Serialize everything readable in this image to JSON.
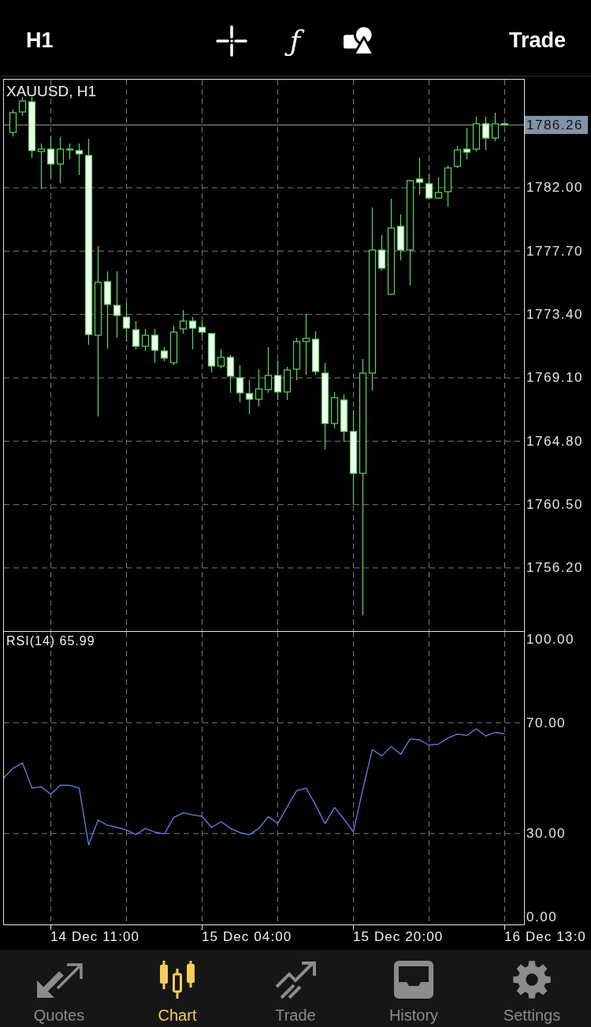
{
  "toolbar": {
    "timeframe": "H1",
    "tools": [
      {
        "kind": "crosshair"
      },
      {
        "kind": "indicators",
        "label": "ƒ"
      },
      {
        "kind": "objects"
      }
    ],
    "action": "Trade"
  },
  "price_chart": {
    "chart_data": {
      "type": "candlestick",
      "title": "XAUUSD, H1",
      "grid": true,
      "categories": [
        null,
        null,
        null,
        null,
        null,
        null,
        null,
        null,
        null,
        null,
        null,
        null,
        null,
        null,
        null,
        null,
        null,
        null,
        null,
        null,
        null,
        null,
        null,
        null,
        null,
        null,
        null,
        null,
        null,
        null,
        null,
        null,
        null,
        null,
        null,
        null,
        null,
        null,
        null,
        null,
        null,
        null,
        null,
        null,
        null,
        null,
        null,
        null,
        null,
        null,
        null,
        null,
        null
      ],
      "ohlc": [
        [
          1785.75,
          1787.3,
          1785.48,
          1787.09
        ],
        [
          1787.14,
          1788.16,
          1786.87,
          1787.89
        ],
        [
          1787.83,
          1788.16,
          1784.03,
          1784.52
        ],
        [
          1784.46,
          1785.0,
          1781.89,
          1784.62
        ],
        [
          1784.62,
          1785.53,
          1782.59,
          1783.61
        ],
        [
          1783.61,
          1785.43,
          1782.32,
          1784.62
        ],
        [
          1784.57,
          1785.0,
          1783.93,
          1784.62
        ],
        [
          1784.52,
          1785.0,
          1782.86,
          1784.3
        ],
        [
          1784.19,
          1785.32,
          1771.35,
          1772.04
        ],
        [
          1771.99,
          1778.04,
          1766.48,
          1775.58
        ],
        [
          1775.63,
          1776.33,
          1771.08,
          1774.08
        ],
        [
          1774.02,
          1776.33,
          1771.83,
          1773.33
        ],
        [
          1773.22,
          1774.18,
          1771.56,
          1772.47
        ],
        [
          1772.36,
          1772.95,
          1771.03,
          1771.24
        ],
        [
          1771.24,
          1772.42,
          1770.92,
          1771.99
        ],
        [
          1771.99,
          1772.42,
          1770.12,
          1770.97
        ],
        [
          1770.92,
          1771.19,
          1770.22,
          1770.44
        ],
        [
          1770.12,
          1772.63,
          1769.96,
          1772.2
        ],
        [
          1772.42,
          1773.7,
          1772.1,
          1772.95
        ],
        [
          1772.95,
          1773.22,
          1771.03,
          1772.47
        ],
        [
          1772.53,
          1772.9,
          1771.99,
          1772.2
        ],
        [
          1772.1,
          1772.15,
          1769.47,
          1769.9
        ],
        [
          1769.9,
          1771.03,
          1769.74,
          1770.49
        ],
        [
          1770.49,
          1770.65,
          1768.08,
          1769.21
        ],
        [
          1769.1,
          1769.96,
          1767.44,
          1768.08
        ],
        [
          1768.03,
          1768.94,
          1766.64,
          1767.65
        ],
        [
          1767.65,
          1769.69,
          1767.17,
          1768.35
        ],
        [
          1768.3,
          1771.19,
          1768.08,
          1769.26
        ],
        [
          1769.26,
          1770.28,
          1767.6,
          1768.14
        ],
        [
          1768.14,
          1769.85,
          1767.6,
          1769.63
        ],
        [
          1769.69,
          1771.83,
          1768.94,
          1771.56
        ],
        [
          1771.56,
          1773.44,
          1769.31,
          1771.78
        ],
        [
          1771.72,
          1772.26,
          1769.31,
          1769.53
        ],
        [
          1769.42,
          1770.12,
          1764.23,
          1766.0
        ],
        [
          1766.0,
          1768.14,
          1765.67,
          1767.76
        ],
        [
          1767.6,
          1767.98,
          1764.76,
          1765.46
        ],
        [
          1765.46,
          1766.9,
          1760.48,
          1762.62
        ],
        [
          1762.62,
          1770.38,
          1752.99,
          1769.42
        ],
        [
          1769.42,
          1780.66,
          1768.24,
          1777.77
        ],
        [
          1777.77,
          1778.79,
          1776.38,
          1776.54
        ],
        [
          1774.77,
          1781.25,
          1774.77,
          1779.27
        ],
        [
          1779.38,
          1780.18,
          1777.08,
          1777.77
        ],
        [
          1777.77,
          1782.54,
          1775.36,
          1782.48
        ],
        [
          1782.59,
          1784.03,
          1781.52,
          1782.37
        ],
        [
          1782.27,
          1782.96,
          1781.2,
          1781.3
        ],
        [
          1781.3,
          1782.7,
          1781.25,
          1781.68
        ],
        [
          1781.73,
          1783.5,
          1780.72,
          1783.34
        ],
        [
          1783.45,
          1784.84,
          1783.34,
          1784.57
        ],
        [
          1784.62,
          1786.07,
          1783.93,
          1784.41
        ],
        [
          1784.62,
          1786.82,
          1784.46,
          1786.34
        ],
        [
          1786.34,
          1786.82,
          1784.57,
          1785.37
        ],
        [
          1785.37,
          1787.09,
          1785.16,
          1786.34
        ],
        [
          1786.34,
          1786.45,
          1786.2,
          1786.26
        ]
      ],
      "ylim": [
        1751.89,
        1789.36
      ],
      "yticks": [
        {
          "value": 1782,
          "label": "1782.00"
        },
        {
          "value": 1777.7,
          "label": "1777.70"
        },
        {
          "value": 1773.4,
          "label": "1773.40"
        },
        {
          "value": 1769.1,
          "label": "1769.10"
        },
        {
          "value": 1764.8,
          "label": "1764.80"
        },
        {
          "value": 1760.5,
          "label": "1760.50"
        },
        {
          "value": 1756.2,
          "label": "1756.20"
        }
      ],
      "ref_lines": [
        {
          "axis": "y",
          "value": 1786.26,
          "label": "1786.26"
        }
      ]
    }
  },
  "rsi_panel": {
    "current_value": "65.99",
    "chart_data": {
      "type": "line",
      "grid": true,
      "ylim": [
        -2.8,
        102.8
      ],
      "yticks": [
        {
          "value": 100,
          "label": "100.00"
        },
        {
          "value": 70,
          "label": "70.00"
        },
        {
          "value": 30,
          "label": "30.00"
        },
        {
          "value": 0,
          "label": "0.00"
        }
      ],
      "series": [
        {
          "name": "RSI(14)",
          "color": "#5d84e6",
          "values": [
            50.0,
            53.6,
            55.5,
            46.4,
            46.9,
            44.2,
            47.5,
            47.4,
            46.4,
            25.9,
            34.9,
            33.0,
            32.2,
            31.3,
            29.6,
            31.9,
            30.5,
            29.9,
            35.8,
            37.5,
            36.7,
            36.2,
            32.2,
            34.3,
            31.9,
            30.3,
            29.6,
            31.9,
            36.1,
            33.6,
            39.7,
            45.5,
            46.4,
            40.3,
            33.6,
            39.4,
            35.2,
            30.6,
            46.1,
            60.3,
            58.0,
            61.4,
            58.6,
            64.2,
            63.8,
            61.9,
            62.3,
            64.5,
            65.9,
            65.4,
            67.8,
            65.2,
            66.5,
            66.0
          ]
        }
      ]
    }
  },
  "time_axis": [
    "14 Dec 11:00",
    "15 Dec 04:00",
    "15 Dec 20:00",
    "16 Dec 13:0"
  ],
  "tab_bar": [
    {
      "label": "Quotes",
      "kind": "quotes",
      "selected": false
    },
    {
      "label": "Chart",
      "kind": "chart",
      "selected": true
    },
    {
      "label": "Trade",
      "kind": "trade",
      "selected": false
    },
    {
      "label": "History",
      "kind": "history",
      "selected": false
    },
    {
      "label": "Settings",
      "kind": "settings",
      "selected": false
    }
  ]
}
